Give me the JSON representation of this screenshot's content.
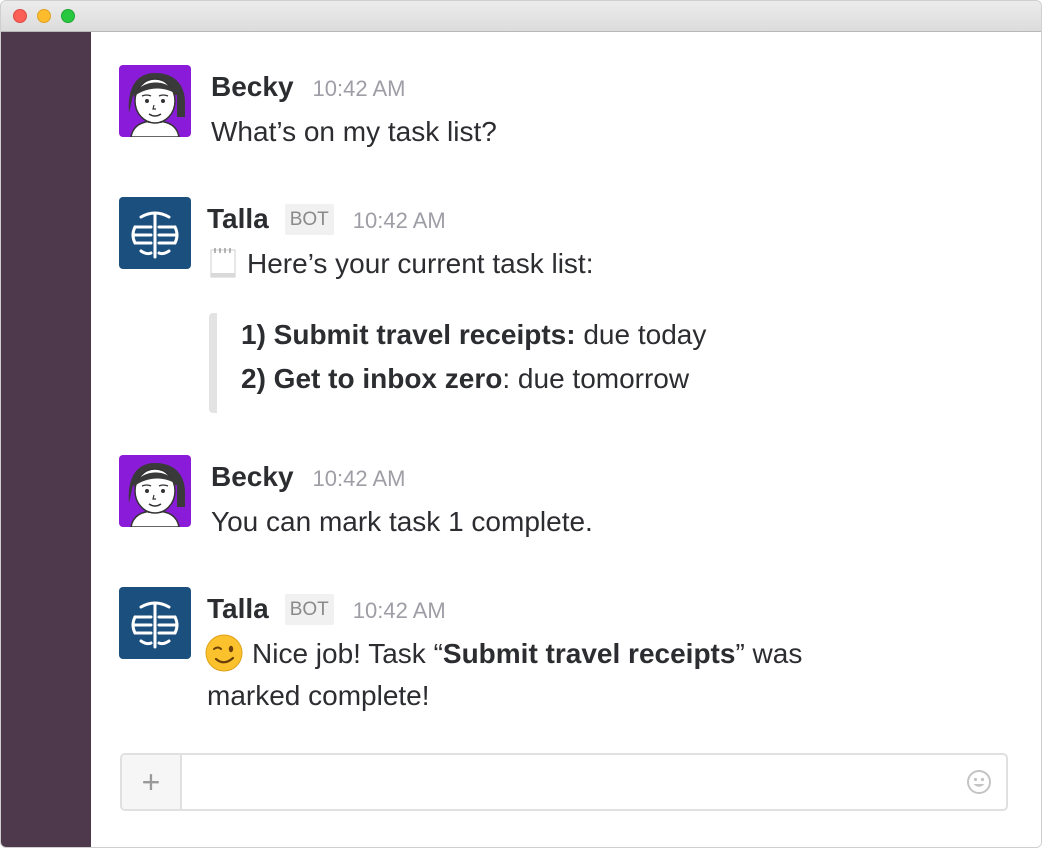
{
  "window": {
    "controls": [
      "close",
      "minimize",
      "maximize"
    ]
  },
  "messages": [
    {
      "author": "Becky",
      "time": "10:42 AM",
      "avatar": "user-avatar-becky",
      "text": "What’s on my task list?"
    },
    {
      "author": "Talla",
      "badge": "BOT",
      "time": "10:42 AM",
      "avatar": "bot-avatar-talla",
      "icon": "notepad-emoji",
      "text": "Here’s your current task list:",
      "tasks": [
        {
          "title": "1) Submit travel receipts:",
          "due": " due today"
        },
        {
          "title": "2) Get to inbox zero",
          "due": ": due tomorrow"
        }
      ]
    },
    {
      "author": "Becky",
      "time": "10:42 AM",
      "avatar": "user-avatar-becky",
      "text": "You can mark task 1 complete."
    },
    {
      "author": "Talla",
      "badge": "BOT",
      "time": "10:42 AM",
      "avatar": "bot-avatar-talla",
      "icon": "winking-face-emoji",
      "text_prefix": "Nice job! Task “",
      "text_bold": "Submit travel receipts",
      "text_suffix": "” was",
      "text_line2": "marked complete!"
    }
  ],
  "composer": {
    "plus_label": "+",
    "placeholder": "",
    "emoji_icon": "smiley-icon"
  },
  "colors": {
    "sidebar": "#4d394b",
    "becky_avatar_bg": "#8a1bd8",
    "talla_avatar_bg": "#1b4f7d"
  }
}
